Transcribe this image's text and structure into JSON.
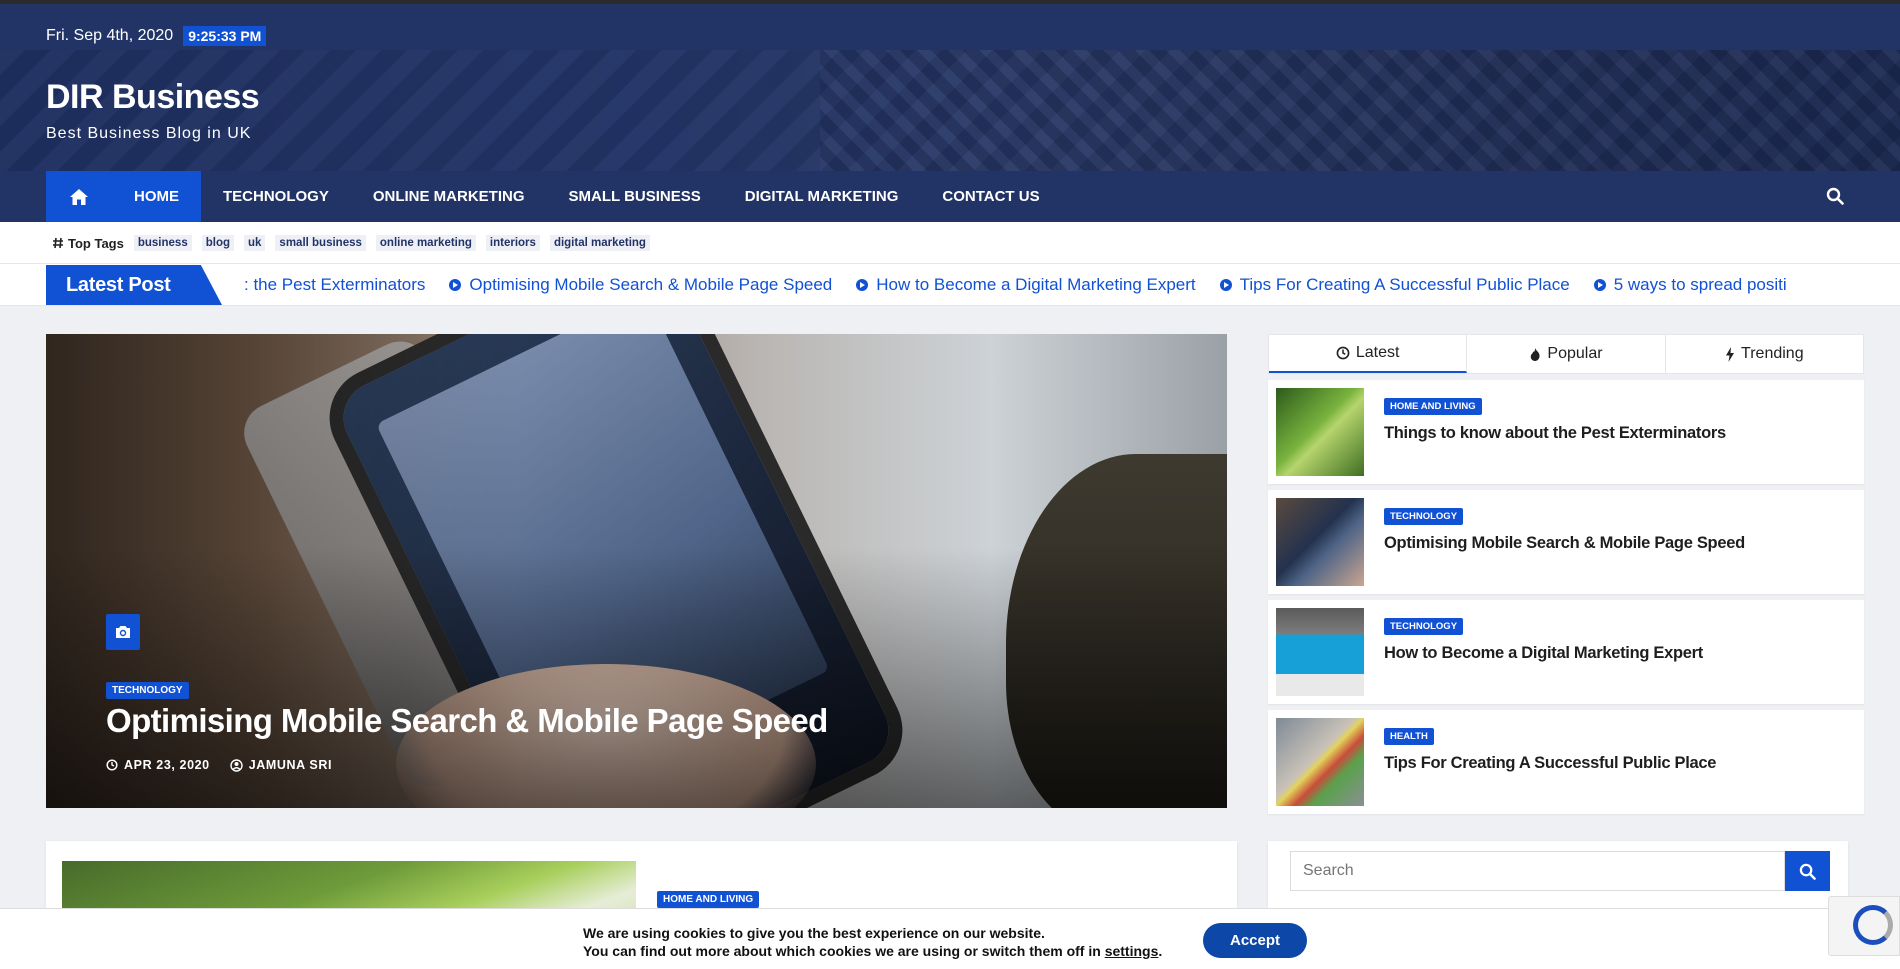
{
  "topbar": {
    "date": "Fri. Sep 4th, 2020",
    "time": "9:25:33 PM"
  },
  "site": {
    "title": "DIR Business",
    "description": "Best Business Blog in UK"
  },
  "nav": {
    "items": [
      {
        "label": "HOME",
        "active": true
      },
      {
        "label": "TECHNOLOGY"
      },
      {
        "label": "ONLINE MARKETING"
      },
      {
        "label": "SMALL BUSINESS"
      },
      {
        "label": "DIGITAL MARKETING"
      },
      {
        "label": "CONTACT US"
      }
    ]
  },
  "tags": {
    "label": "Top Tags",
    "items": [
      "business",
      "blog",
      "uk",
      "small business",
      "online marketing",
      "interiors",
      "digital marketing"
    ]
  },
  "ticker": {
    "label": "Latest Post",
    "items": [
      ": the Pest Exterminators",
      "Optimising Mobile Search & Mobile Page Speed",
      "How to Become a Digital Marketing Expert",
      "Tips For Creating A Successful Public Place",
      "5 ways to spread positi"
    ]
  },
  "hero": {
    "category": "TECHNOLOGY",
    "title": "Optimising Mobile Search & Mobile Page Speed",
    "date": "APR 23, 2020",
    "author": "JAMUNA SRI"
  },
  "second_card": {
    "category": "HOME AND LIVING"
  },
  "sidebar": {
    "tabs": [
      "Latest",
      "Popular",
      "Trending"
    ],
    "posts": [
      {
        "category": "HOME AND LIVING",
        "title": "Things to know about the Pest Exterminators"
      },
      {
        "category": "TECHNOLOGY",
        "title": "Optimising Mobile Search & Mobile Page Speed"
      },
      {
        "category": "TECHNOLOGY",
        "title": "How to Become a Digital Marketing Expert"
      },
      {
        "category": "HEALTH",
        "title": "Tips For Creating A Successful Public Place"
      }
    ]
  },
  "search": {
    "placeholder": "Search"
  },
  "cookie": {
    "line1": "We are using cookies to give you the best experience on our website.",
    "line2": "You can find out more about which cookies we are using or switch them off in",
    "link": "settings",
    "end": ".",
    "accept": "Accept"
  },
  "colors": {
    "primary": "#1151d3",
    "navy": "#223466"
  }
}
